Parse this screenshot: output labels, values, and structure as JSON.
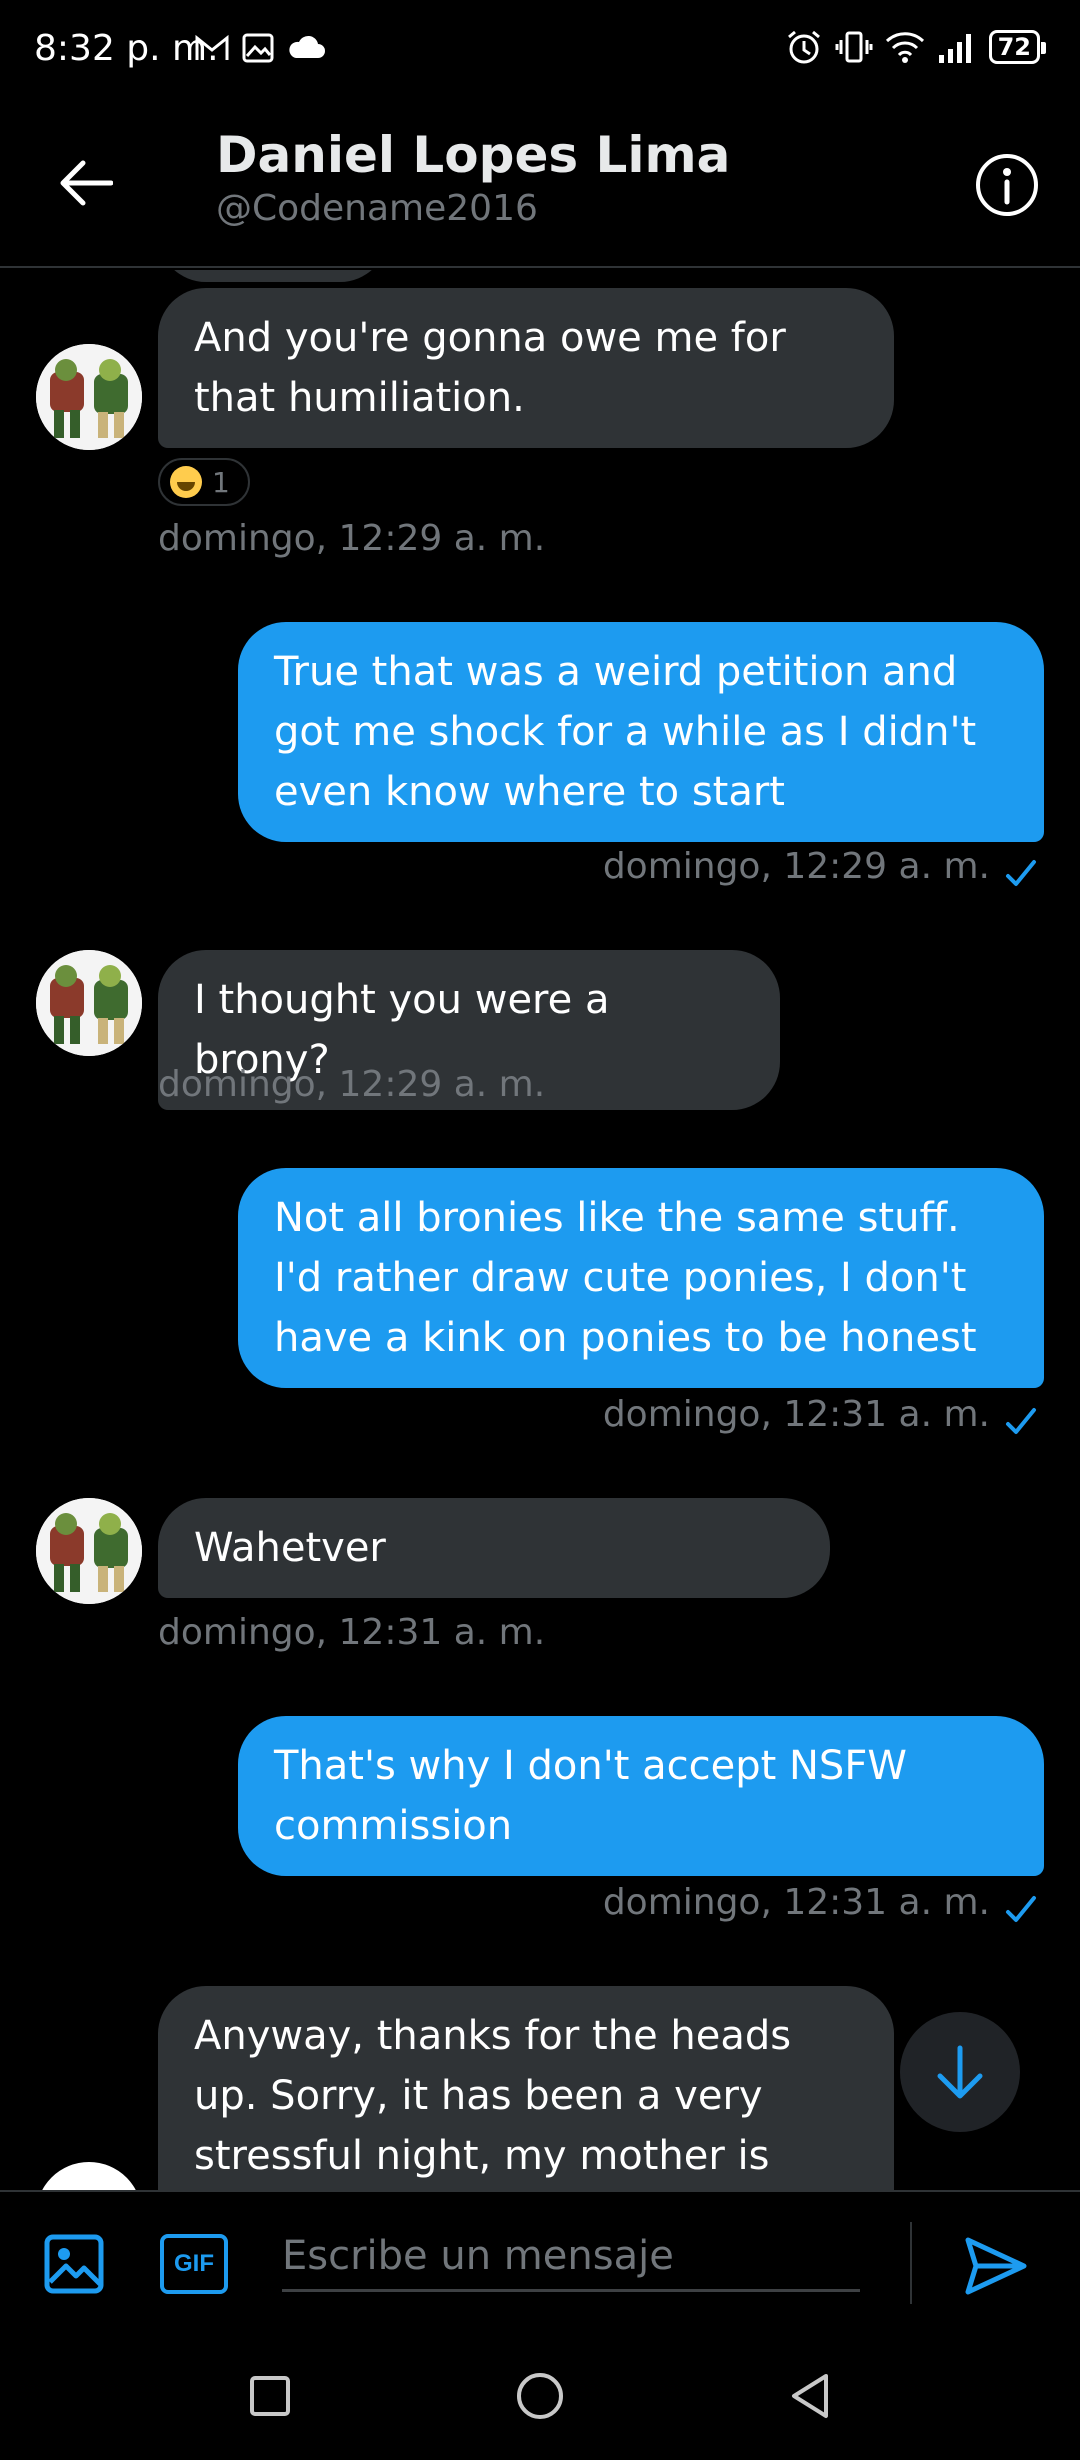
{
  "status_bar": {
    "time": "8:32 p. m.",
    "battery": "72",
    "notification_icons": [
      "gmail-icon",
      "gallery-icon",
      "cloud-icon"
    ],
    "system_icons": [
      "alarm-icon",
      "vibrate-icon",
      "wifi-icon",
      "signal-icon"
    ]
  },
  "header": {
    "name": "Daniel Lopes Lima",
    "handle": "@Codename2016"
  },
  "messages": [
    {
      "direction": "in",
      "text": "And you're gonna owe me for that humiliation.",
      "timestamp": "domingo, 12:29 a. m.",
      "reaction": {
        "emoji": "face-with-tears-of-joy",
        "count": "1"
      }
    },
    {
      "direction": "out",
      "text": "True that was a weird petition and got me shock for a while as I didn't even know where to start",
      "timestamp": "domingo, 12:29 a. m.",
      "seen": true
    },
    {
      "direction": "in",
      "text": "I thought you were a brony?",
      "timestamp": "domingo, 12:29 a. m."
    },
    {
      "direction": "out",
      "text": "Not all bronies like the same stuff. I'd rather draw cute ponies, I don't have a kink on ponies to be honest",
      "timestamp": "domingo, 12:31 a. m.",
      "seen": true
    },
    {
      "direction": "in",
      "text": "Wahetver",
      "timestamp": "domingo, 12:31 a. m."
    },
    {
      "direction": "out",
      "text": "That's why I don't accept NSFW commission",
      "timestamp": "domingo, 12:31 a. m.",
      "seen": true
    },
    {
      "direction": "in",
      "text": "Anyway, thanks for the heads up. Sorry, it has been a very stressful night, my mother is"
    }
  ],
  "composer": {
    "placeholder": "Escribe un mensaje",
    "gif_label": "GIF"
  },
  "colors": {
    "background": "#000000",
    "accent": "#1d9bf0",
    "incoming_bubble": "#2f3336",
    "muted_text": "#71767b"
  }
}
